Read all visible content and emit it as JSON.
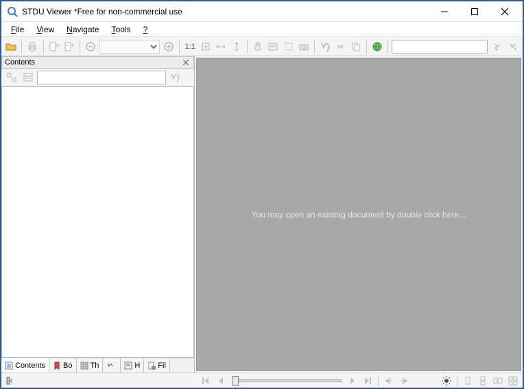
{
  "window": {
    "title": "STDU Viewer *Free for non-commercial use"
  },
  "menu": {
    "file": "File",
    "view": "View",
    "navigate": "Navigate",
    "tools": "Tools",
    "help": "?"
  },
  "toolbar": {
    "zoom_value": "",
    "ratio_label": "1:1",
    "search_value": ""
  },
  "sidebar": {
    "panel_title": "Contents",
    "filter_value": "",
    "tabs": {
      "contents": "Contents",
      "bo": "Bo",
      "th": "Th",
      "se": "",
      "h": "H",
      "fil": "Fil"
    }
  },
  "viewer": {
    "placeholder": "You may open an existing document by double click here..."
  },
  "colors": {
    "frame": "#2a5a9f",
    "view_bg": "#a8a8a8"
  }
}
